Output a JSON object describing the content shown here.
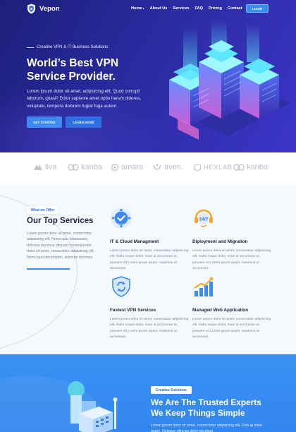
{
  "brand": {
    "name": "Vepon"
  },
  "nav": {
    "items": [
      "Home",
      "About Us",
      "Services",
      "FAQ",
      "Pricing",
      "Contact"
    ],
    "home_caret": "▾",
    "login_label": "LOGIN"
  },
  "hero": {
    "eyebrow": "Creative VPN & IT Business Solutions",
    "title": "World’s Best VPN Service Provider.",
    "description": "Lorem ipsum dolor sit amet, adipisicing elit. Quod corrupti laborum, quasi? Dolor sapiente amet optio harum dolores, voluptate, tempora dolorem fugiat fuga autem .",
    "primary_button": "GET STARTED",
    "secondary_button": "LEARN MORE"
  },
  "partners": [
    "liva",
    "kanba",
    "amara",
    "aven.",
    "HEXLAB",
    "kanba"
  ],
  "services": {
    "badge": "What we Offer",
    "heading": "Our Top Services",
    "description": "Lorem ipsum dolor sit amet, consectetur adipisicing elit. Nemo quo laboriosam, dolorum ducimus aliquam consequuntur dolor sit amet, consectetur adipisicing elit. Nemo quo laboriosam, dolorum ducimus",
    "cards": [
      {
        "title": "IT & Cloud Managment",
        "icon": "cloud-check-icon",
        "text": "Lorem ipsum dolor sit amet, consectetur adipisicing elit. Nulla neque dolor, maxi ut accumsan ut, posuere sit Lorem ipsum quam, maximus ut accumsan."
      },
      {
        "title": "Diployment and Migration",
        "icon": "support-24-7-icon",
        "text": "Lorem ipsum dolor sit amet, consectetur adipisicing elit. Nulla neque dolor, maxi ut accumsan ut, posuere sit Lorem ipsum quam, maximus ut accumsan."
      },
      {
        "title": "Fastest VPN Services",
        "icon": "shield-sync-icon",
        "text": "Lorem ipsum dolor sit amet, consectetur adipisicing elit. Nulla neque dolor, maxi ut accumsan ut, posuere sit Lorem ipsum quam, maximus ut accumsan."
      },
      {
        "title": "Managed Web Application",
        "icon": "growth-chart-icon",
        "text": "Lorem ipsum dolor sit amet, consectetur adipisicing elit. Nulla neque dolor, maxi ut accumsan ut, posuere sit Lorem ipsum quam, maximus ut accumsan."
      }
    ]
  },
  "trusted": {
    "badge": "Creative Solutions",
    "title_line1": "We Are The Trusted Experts",
    "title_line2": "We Keep Things Simple",
    "description": "Lorem ipsum dolor sit amet, consectetur adipisicing elit. Duis at dolor quam. Quisque ultricies dolor tincidunt."
  },
  "colors": {
    "hero_bg": "#2a2ba0",
    "accent": "#3d8af0",
    "trusted_bg": "#3a92f3",
    "heading": "#1b2340"
  }
}
